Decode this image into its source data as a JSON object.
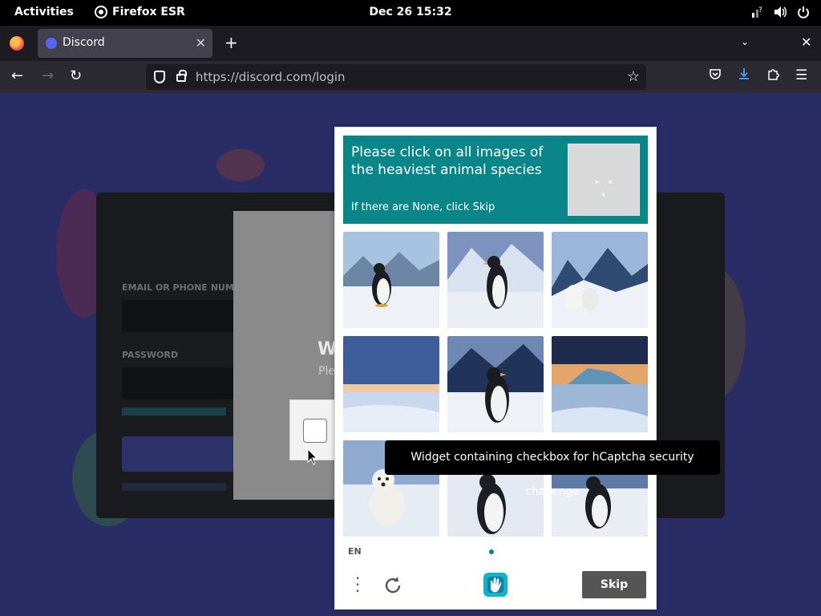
{
  "topbar": {
    "activities": "Activities",
    "app_name": "Firefox ESR",
    "clock": "Dec 26  15:32"
  },
  "browser": {
    "tab_title": "Discord",
    "url_host": "https://discord.com",
    "url_path": "/login"
  },
  "login": {
    "email_label": "EMAIL OR PHONE NUMBE",
    "password_label": "PASSWORD",
    "welcome_fragment": "W",
    "welcome_sub_fragment": "Ple"
  },
  "captcha": {
    "prompt": "Please click on all images of the heaviest animal species",
    "hint": "If there are None, click Skip",
    "example_dots": "• • •",
    "language": "EN",
    "skip_label": "Skip",
    "images": [
      {
        "subject": "penguin"
      },
      {
        "subject": "penguin"
      },
      {
        "subject": "polar bears"
      },
      {
        "subject": "snow landscape"
      },
      {
        "subject": "penguin"
      },
      {
        "subject": "iceberg landscape"
      },
      {
        "subject": "polar bear"
      },
      {
        "subject": "penguin"
      },
      {
        "subject": "penguin"
      }
    ]
  },
  "tooltip": "Widget containing checkbox for hCaptcha security challenge",
  "colors": {
    "prompt_bg": "#0a8588",
    "skip_bg": "#555555",
    "page_bg": "#2a2c66"
  }
}
